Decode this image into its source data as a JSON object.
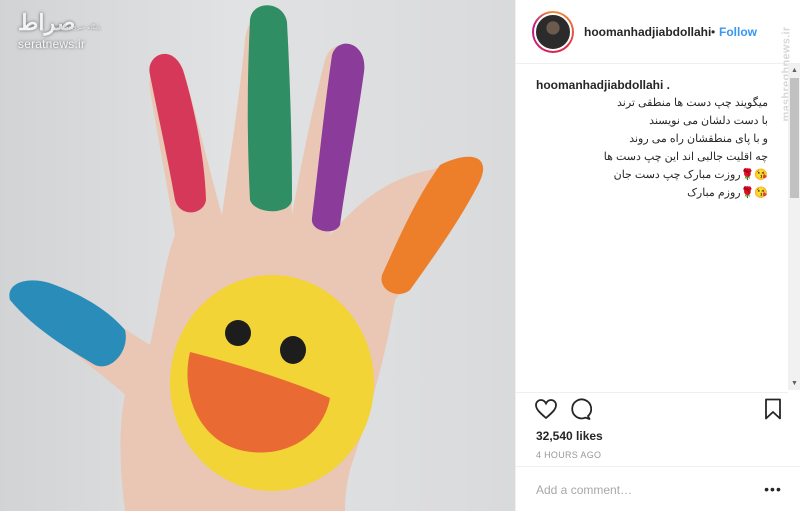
{
  "photo": {
    "watermark_brand": "صراط",
    "watermark_tagline": "پایگاه خبری تحلیلی",
    "watermark_site": "seratnews.ir"
  },
  "header": {
    "username": "hoomanhadjiabdollahi",
    "separator": "•",
    "follow_label": "Follow"
  },
  "side_watermark": "mashreghnews.ir",
  "caption": {
    "username": "hoomanhadjiabdollahi .",
    "lines": [
      "میگویند چپ دست ها منطقی ترند",
      "با دست دلشان می نویسند",
      "و با پای منطقشان راه می روند",
      "چه اقلیت جالبی اند این چپ دست ها",
      "😘🌹روزت مبارک چپ دست جان",
      "😘🌹روزم مبارک"
    ]
  },
  "actions": {
    "likes": "32,540 likes",
    "time": "4 HOURS AGO"
  },
  "add_comment": {
    "placeholder": "Add a comment…",
    "more": "•••"
  },
  "icons": {
    "like": "heart-icon",
    "comment": "comment-icon",
    "save": "bookmark-icon",
    "more": "more-dots-icon"
  },
  "colors": {
    "link": "#3897f0",
    "text": "#262626",
    "muted": "#999999",
    "border": "#efefef"
  }
}
